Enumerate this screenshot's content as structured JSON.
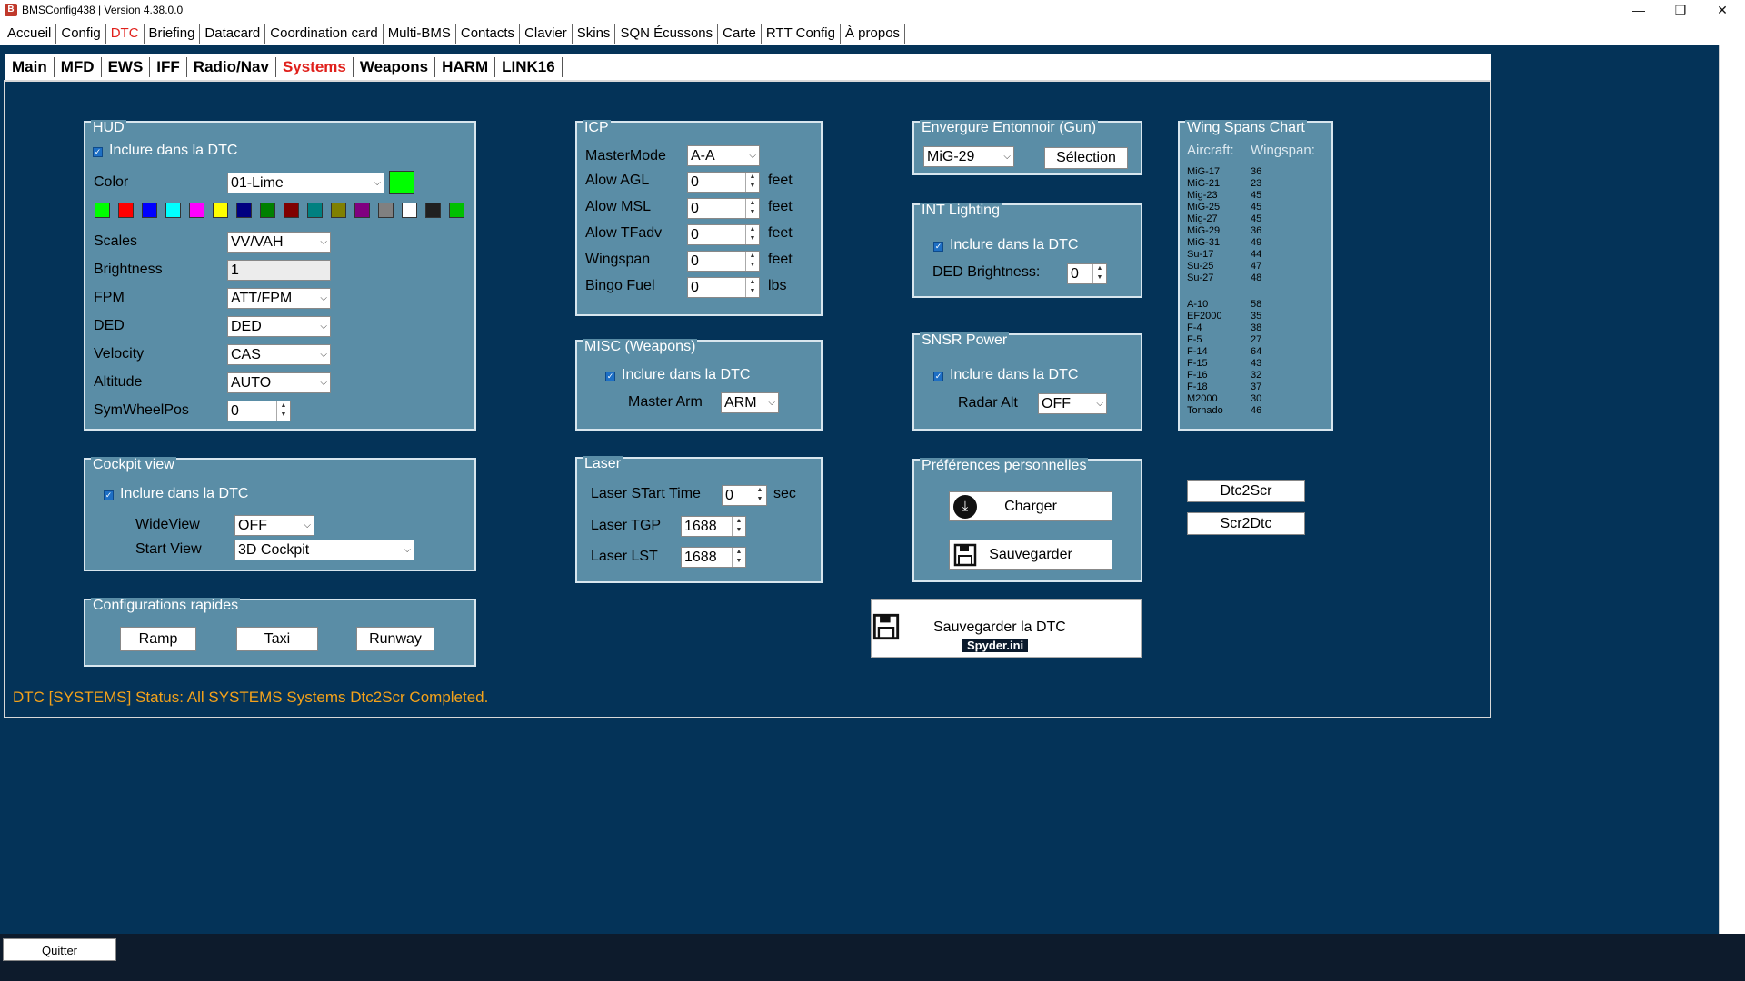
{
  "window": {
    "title": "BMSConfig438 | Version 4.38.0.0",
    "logo_letter": "B",
    "minimize": "—",
    "maximize": "❐",
    "close": "✕"
  },
  "menu": [
    "Accueil",
    "Config",
    "DTC",
    "Briefing",
    "Datacard",
    "Coordination card",
    "Multi-BMS",
    "Contacts",
    "Clavier",
    "Skins",
    "SQN Écussons",
    "Carte",
    "RTT Config",
    "À propos"
  ],
  "menu_active": "DTC",
  "subtabs": [
    "Main",
    "MFD",
    "EWS",
    "IFF",
    "Radio/Nav",
    "Systems",
    "Weapons",
    "HARM",
    "LINK16"
  ],
  "subtab_active": "Systems",
  "hud": {
    "title": "HUD",
    "include": "Inclure dans la DTC",
    "color_label": "Color",
    "color_value": "01-Lime",
    "color_preview": "#00ff00",
    "swatches": [
      "#00ff00",
      "#ff0000",
      "#0000ff",
      "#00ffff",
      "#ff00ff",
      "#ffff00",
      "#000080",
      "#008000",
      "#800000",
      "#008080",
      "#808000",
      "#800080",
      "#808080",
      "#ffffff",
      "#202020",
      "#00c000"
    ],
    "scales_label": "Scales",
    "scales_value": "VV/VAH",
    "brightness_label": "Brightness",
    "brightness_value": "1",
    "fpm_label": "FPM",
    "fpm_value": "ATT/FPM",
    "ded_label": "DED",
    "ded_value": "DED",
    "velocity_label": "Velocity",
    "velocity_value": "CAS",
    "altitude_label": "Altitude",
    "altitude_value": "AUTO",
    "symwheel_label": "SymWheelPos",
    "symwheel_value": "0"
  },
  "cockpit": {
    "title": "Cockpit view",
    "include": "Inclure dans la DTC",
    "wideview_label": "WideView",
    "wideview_value": "OFF",
    "startview_label": "Start View",
    "startview_value": "3D Cockpit"
  },
  "quick": {
    "title": "Configurations rapides",
    "ramp": "Ramp",
    "taxi": "Taxi",
    "runway": "Runway"
  },
  "icp": {
    "title": "ICP",
    "mastermode_label": "MasterMode",
    "mastermode_value": "A-A",
    "agl_label": "Alow AGL",
    "agl_value": "0",
    "agl_unit": "feet",
    "msl_label": "Alow MSL",
    "msl_value": "0",
    "msl_unit": "feet",
    "tfadv_label": "Alow TFadv",
    "tfadv_value": "0",
    "tfadv_unit": "feet",
    "wingspan_label": "Wingspan",
    "wingspan_value": "0",
    "wingspan_unit": "feet",
    "bingo_label": "Bingo Fuel",
    "bingo_value": "0",
    "bingo_unit": "lbs"
  },
  "misc": {
    "title": "MISC (Weapons)",
    "include": "Inclure dans la DTC",
    "masterarm_label": "Master Arm",
    "masterarm_value": "ARM"
  },
  "laser": {
    "title": "Laser",
    "start_label": "Laser STart Time",
    "start_value": "0",
    "start_unit": "sec",
    "tgp_label": "Laser TGP",
    "tgp_value": "1688",
    "lst_label": "Laser LST",
    "lst_value": "1688"
  },
  "envergure": {
    "title": "Envergure Entonnoir (Gun)",
    "aircraft_value": "MiG-29",
    "select_btn": "Sélection"
  },
  "intlight": {
    "title": "INT Lighting",
    "include": "Inclure dans la DTC",
    "ded_label": "DED Brightness:",
    "ded_value": "0"
  },
  "snsr": {
    "title": "SNSR Power",
    "include": "Inclure dans la DTC",
    "radar_label": "Radar Alt",
    "radar_value": "OFF"
  },
  "prefs": {
    "title": "Préférences personnelles",
    "load": "Charger",
    "save": "Sauvegarder"
  },
  "save_dtc": {
    "label": "Sauvegarder la DTC",
    "file": "Spyder.ini"
  },
  "wing": {
    "title": "Wing Spans Chart",
    "col1": "Aircraft:",
    "col2": "Wingspan:",
    "group1": [
      [
        "MiG-17",
        "36"
      ],
      [
        "MiG-21",
        "23"
      ],
      [
        "Mig-23",
        "45"
      ],
      [
        "MiG-25",
        "45"
      ],
      [
        "Mig-27",
        "45"
      ],
      [
        "MiG-29",
        "36"
      ],
      [
        "MiG-31",
        "49"
      ],
      [
        "Su-17",
        "44"
      ],
      [
        "Su-25",
        "47"
      ],
      [
        "Su-27",
        "48"
      ]
    ],
    "group2": [
      [
        "A-10",
        "58"
      ],
      [
        "EF2000",
        "35"
      ],
      [
        "F-4",
        "38"
      ],
      [
        "F-5",
        "27"
      ],
      [
        "F-14",
        "64"
      ],
      [
        "F-15",
        "43"
      ],
      [
        "F-16",
        "32"
      ],
      [
        "F-18",
        "37"
      ],
      [
        "M2000",
        "30"
      ],
      [
        "Tornado",
        "46"
      ]
    ]
  },
  "dtc2scr": "Dtc2Scr",
  "scr2dtc": "Scr2Dtc",
  "status": "DTC [SYSTEMS] Status: All SYSTEMS Systems Dtc2Scr Completed.",
  "quit": "Quitter"
}
